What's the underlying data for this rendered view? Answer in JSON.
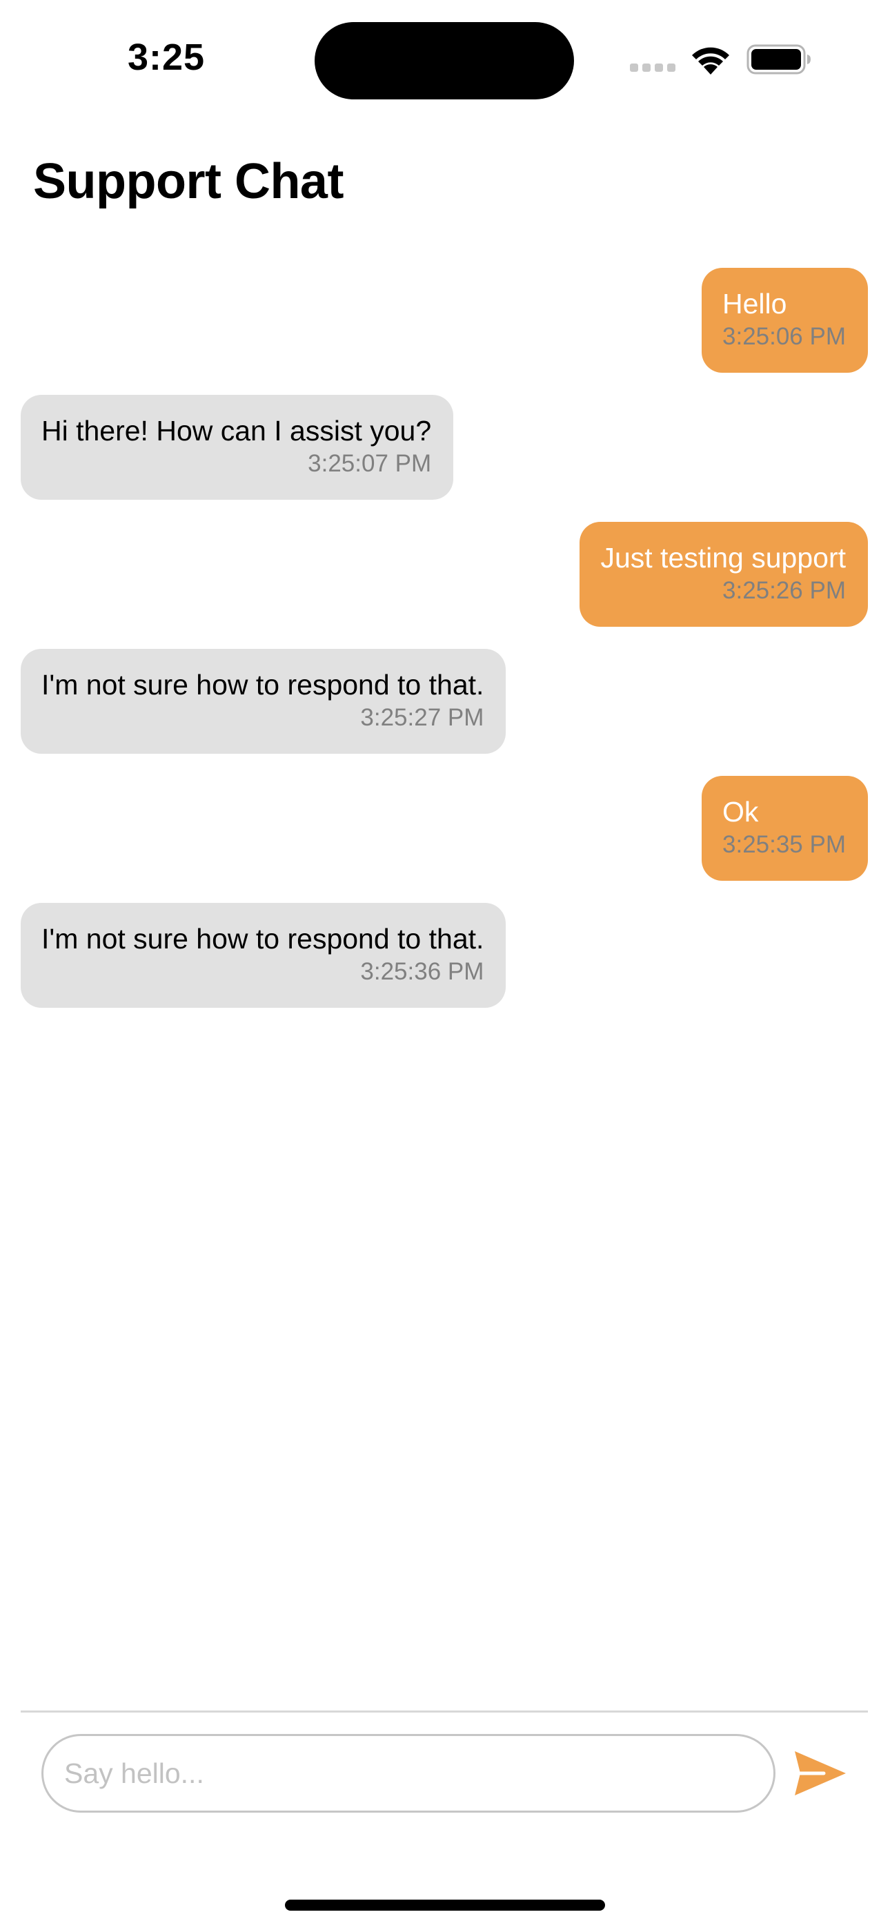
{
  "status_bar": {
    "time": "3:25"
  },
  "header": {
    "title": "Support Chat"
  },
  "messages": [
    {
      "direction": "outgoing",
      "text": "Hello",
      "time": "3:25:06 PM"
    },
    {
      "direction": "incoming",
      "text": "Hi there! How can I assist you?",
      "time": "3:25:07 PM"
    },
    {
      "direction": "outgoing",
      "text": "Just testing support",
      "time": "3:25:26 PM"
    },
    {
      "direction": "incoming",
      "text": "I'm not sure how to respond to that.",
      "time": "3:25:27 PM"
    },
    {
      "direction": "outgoing",
      "text": "Ok",
      "time": "3:25:35 PM"
    },
    {
      "direction": "incoming",
      "text": "I'm not sure how to respond to that.",
      "time": "3:25:36 PM"
    }
  ],
  "composer": {
    "placeholder": "Say hello...",
    "value": "",
    "send_icon": "paperplane-icon"
  },
  "colors": {
    "accent": "#f0a04b",
    "incoming_bubble": "#e1e1e1",
    "timestamp": "#808080"
  }
}
